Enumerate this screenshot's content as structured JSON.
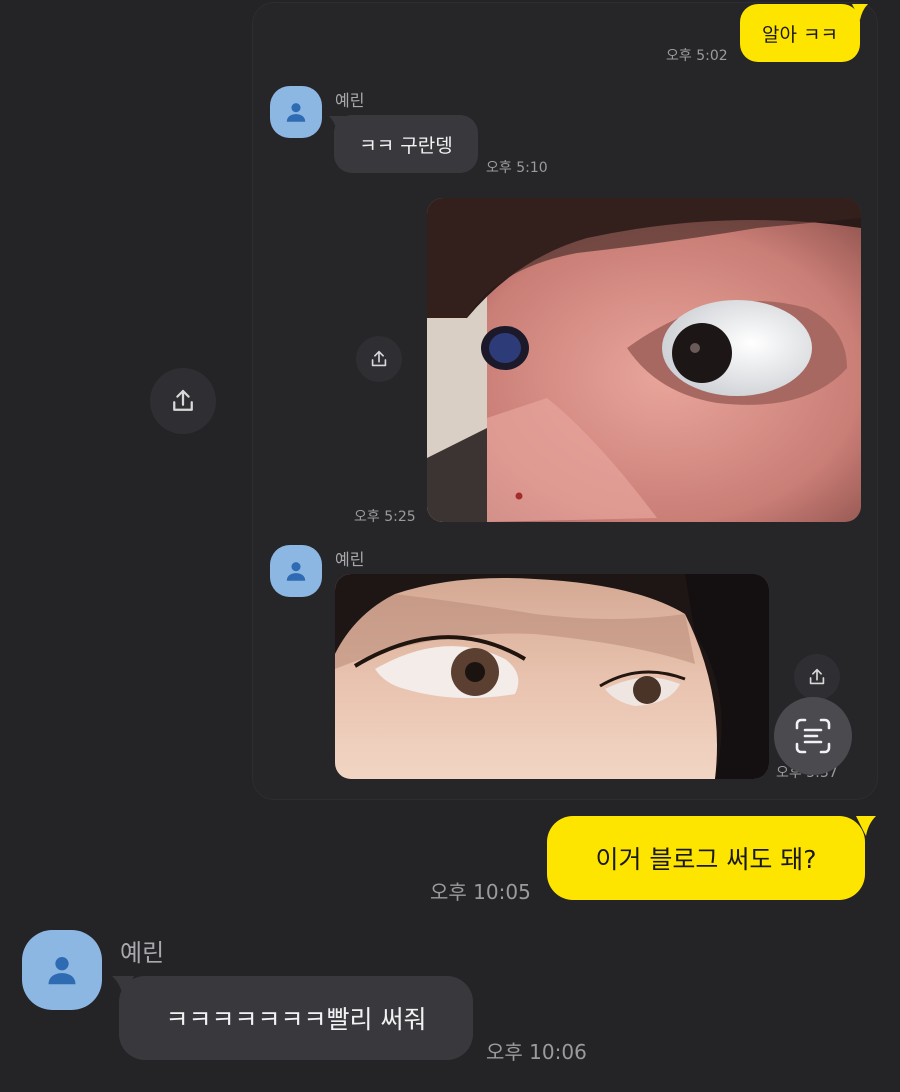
{
  "messages": {
    "m1": {
      "text": "알아 ㅋㅋ",
      "time": "오후 5:02"
    },
    "m2": {
      "sender": "예린",
      "text": "ㅋㅋ 구란뎅",
      "time": "오후 5:10"
    },
    "m3": {
      "time": "오후 5:25"
    },
    "m4": {
      "sender": "예린",
      "time": "오후 5:37"
    },
    "m5": {
      "text": "이거 블로그 써도 돼?",
      "time": "오후 10:05"
    },
    "m6": {
      "sender": "예린",
      "text": "ㅋㅋㅋㅋㅋㅋㅋ빨리 써줘",
      "time": "오후 10:06"
    }
  },
  "colors": {
    "background": "#242427",
    "incoming_bubble": "#39393d",
    "outgoing_bubble": "#fee500",
    "avatar": "#8db7e3"
  },
  "icons": {
    "avatar": "person-icon",
    "share": "share-icon",
    "scan": "text-scan-icon"
  }
}
